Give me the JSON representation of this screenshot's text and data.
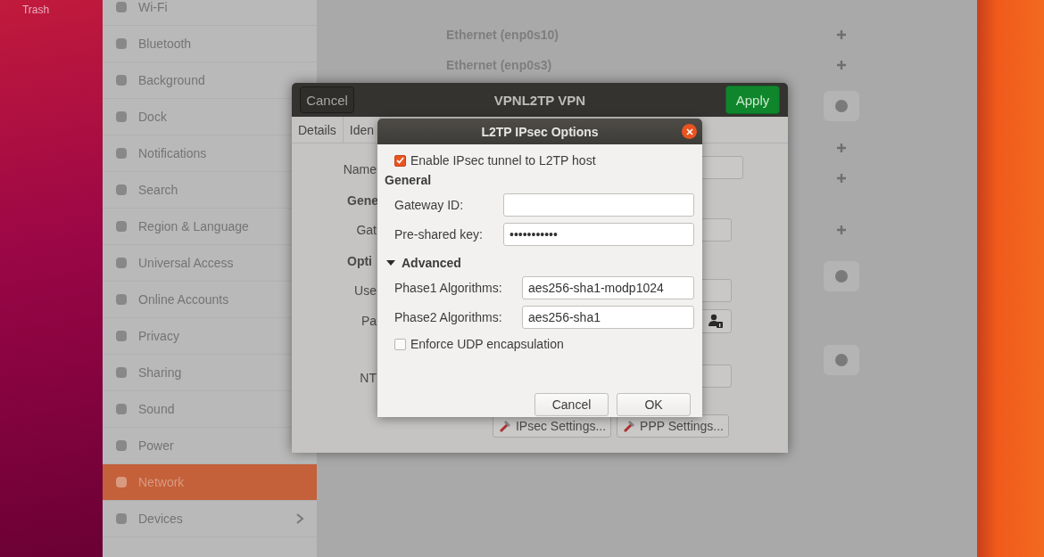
{
  "desktop": {
    "trash_label": "Trash"
  },
  "settings": {
    "sidebar": [
      {
        "label": "Wi-Fi",
        "selected": false,
        "has_arrow": false
      },
      {
        "label": "Bluetooth",
        "selected": false,
        "has_arrow": false
      },
      {
        "label": "Background",
        "selected": false,
        "has_arrow": false
      },
      {
        "label": "Dock",
        "selected": false,
        "has_arrow": false
      },
      {
        "label": "Notifications",
        "selected": false,
        "has_arrow": false
      },
      {
        "label": "Search",
        "selected": false,
        "has_arrow": false
      },
      {
        "label": "Region & Language",
        "selected": false,
        "has_arrow": false
      },
      {
        "label": "Universal Access",
        "selected": false,
        "has_arrow": false
      },
      {
        "label": "Online Accounts",
        "selected": false,
        "has_arrow": false
      },
      {
        "label": "Privacy",
        "selected": false,
        "has_arrow": false
      },
      {
        "label": "Sharing",
        "selected": false,
        "has_arrow": false
      },
      {
        "label": "Sound",
        "selected": false,
        "has_arrow": false
      },
      {
        "label": "Power",
        "selected": false,
        "has_arrow": false
      },
      {
        "label": "Network",
        "selected": true,
        "has_arrow": false
      },
      {
        "label": "Devices",
        "selected": false,
        "has_arrow": true
      }
    ],
    "network_rows": [
      {
        "label": "Ethernet (enp0s10)"
      },
      {
        "label": "Ethernet (enp0s3)"
      }
    ]
  },
  "vpn_dialog": {
    "title": "VPNL2TP VPN",
    "cancel": "Cancel",
    "apply": "Apply",
    "tabs": [
      {
        "label": "Details"
      },
      {
        "label": "Iden"
      }
    ],
    "rows": [
      {
        "kind": "field",
        "label": "Name"
      },
      {
        "kind": "heading",
        "label": "Gene"
      },
      {
        "kind": "field",
        "label": "Gat"
      },
      {
        "kind": "heading",
        "label": "Opti"
      },
      {
        "kind": "field",
        "label": "Use"
      },
      {
        "kind": "password",
        "label": "Pa"
      },
      {
        "kind": "field",
        "label": "NT"
      }
    ],
    "buttons": [
      "IPsec Settings...",
      "PPP Settings..."
    ]
  },
  "ipsec_dialog": {
    "title": "L2TP IPsec Options",
    "enable": {
      "label": "Enable IPsec tunnel to L2TP host",
      "checked": true
    },
    "general_heading": "General",
    "general_fields": [
      {
        "label": "Gateway ID:"
      },
      {
        "label": "Pre-shared key:",
        "value": "•••••••••••"
      }
    ],
    "advanced": {
      "label": "Advanced",
      "expanded": true
    },
    "advanced_fields": [
      {
        "label": "Phase1 Algorithms:",
        "value": "aes256-sha1-modp1024"
      },
      {
        "label": "Phase2 Algorithms:",
        "value": "aes256-sha1"
      }
    ],
    "enforce_udp": {
      "label": "Enforce UDP encapsulation",
      "checked": false
    },
    "buttons": [
      "Cancel",
      "OK"
    ]
  }
}
